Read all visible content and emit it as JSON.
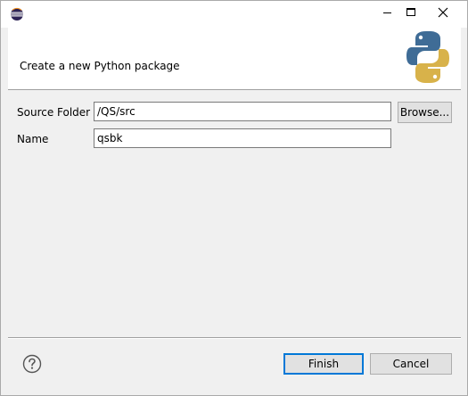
{
  "window": {
    "title": "",
    "icons": {
      "app": "eclipse-icon",
      "minimize": "minimize-icon",
      "maximize": "maximize-icon",
      "close": "close-icon"
    }
  },
  "banner": {
    "message": "Create a new Python package",
    "logo": "python-logo"
  },
  "form": {
    "source_folder_label": "Source Folder",
    "source_folder_value": "/QS/src",
    "browse_label": "Browse...",
    "name_label": "Name",
    "name_value": "qsbk"
  },
  "footer": {
    "help_icon": "help-icon",
    "finish_label": "Finish",
    "cancel_label": "Cancel"
  },
  "colors": {
    "python_blue": "#3f6c96",
    "python_yellow": "#d8b24a",
    "accent": "#0078d7"
  }
}
